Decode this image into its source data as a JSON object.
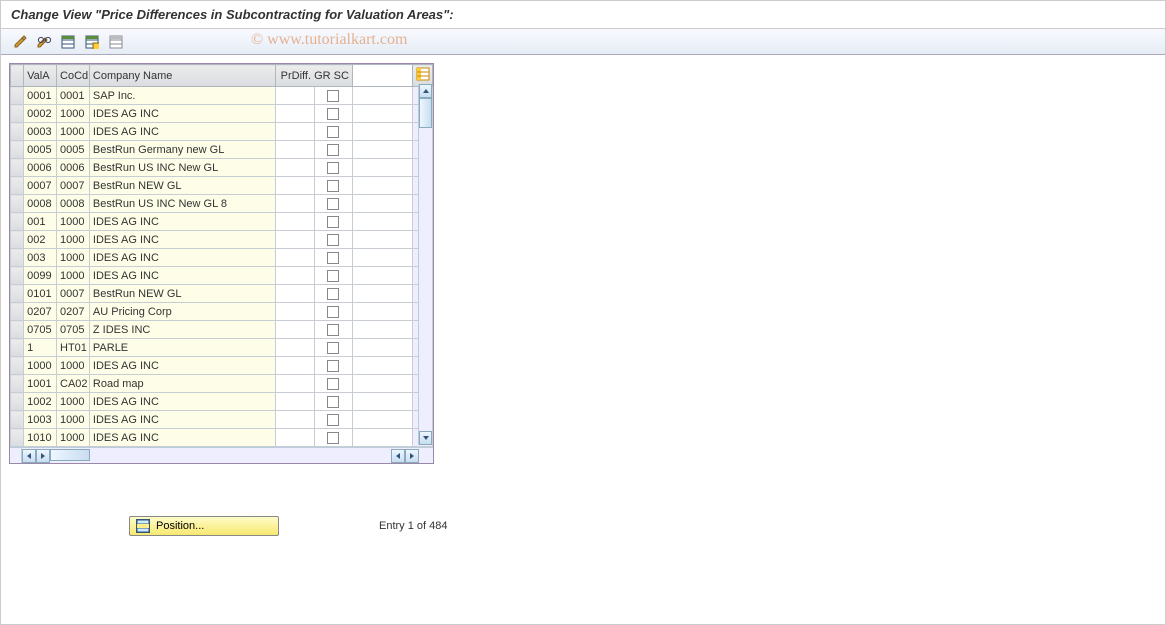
{
  "title": "Change View \"Price Differences in Subcontracting for Valuation Areas\":",
  "watermark": "© www.tutorialkart.com",
  "toolbar_icons": [
    "change-pencil-icon",
    "glasses-icon",
    "table-icon",
    "save-table-icon",
    "delete-table-icon"
  ],
  "columns": {
    "vala": "ValA",
    "cocd": "CoCd",
    "cname": "Company Name",
    "prdiff": "PrDiff. GR SC"
  },
  "rows": [
    {
      "vala": "0001",
      "cocd": "0001",
      "cname": "SAP Inc.",
      "prdiff": false
    },
    {
      "vala": "0002",
      "cocd": "1000",
      "cname": "IDES AG INC",
      "prdiff": false
    },
    {
      "vala": "0003",
      "cocd": "1000",
      "cname": "IDES AG INC",
      "prdiff": false
    },
    {
      "vala": "0005",
      "cocd": "0005",
      "cname": "BestRun Germany new GL",
      "prdiff": false
    },
    {
      "vala": "0006",
      "cocd": "0006",
      "cname": "BestRun US INC New GL",
      "prdiff": false
    },
    {
      "vala": "0007",
      "cocd": "0007",
      "cname": "BestRun NEW GL",
      "prdiff": false
    },
    {
      "vala": "0008",
      "cocd": "0008",
      "cname": "BestRun US INC New GL 8",
      "prdiff": false
    },
    {
      "vala": "001",
      "cocd": "1000",
      "cname": "IDES AG INC",
      "prdiff": false
    },
    {
      "vala": "002",
      "cocd": "1000",
      "cname": "IDES AG INC",
      "prdiff": false
    },
    {
      "vala": "003",
      "cocd": "1000",
      "cname": "IDES AG INC",
      "prdiff": false
    },
    {
      "vala": "0099",
      "cocd": "1000",
      "cname": "IDES AG INC",
      "prdiff": false
    },
    {
      "vala": "0101",
      "cocd": "0007",
      "cname": "BestRun NEW GL",
      "prdiff": false
    },
    {
      "vala": "0207",
      "cocd": "0207",
      "cname": "AU Pricing Corp",
      "prdiff": false
    },
    {
      "vala": "0705",
      "cocd": "0705",
      "cname": "Z IDES INC",
      "prdiff": false
    },
    {
      "vala": "1",
      "cocd": "HT01",
      "cname": "PARLE",
      "prdiff": false
    },
    {
      "vala": "1000",
      "cocd": "1000",
      "cname": "IDES AG INC",
      "prdiff": false
    },
    {
      "vala": "1001",
      "cocd": "CA02",
      "cname": "Road map",
      "prdiff": false
    },
    {
      "vala": "1002",
      "cocd": "1000",
      "cname": "IDES AG INC",
      "prdiff": false
    },
    {
      "vala": "1003",
      "cocd": "1000",
      "cname": "IDES AG INC",
      "prdiff": false
    },
    {
      "vala": "1010",
      "cocd": "1000",
      "cname": "IDES AG INC",
      "prdiff": false
    }
  ],
  "position_button": "Position...",
  "entry_text": "Entry 1 of 484"
}
